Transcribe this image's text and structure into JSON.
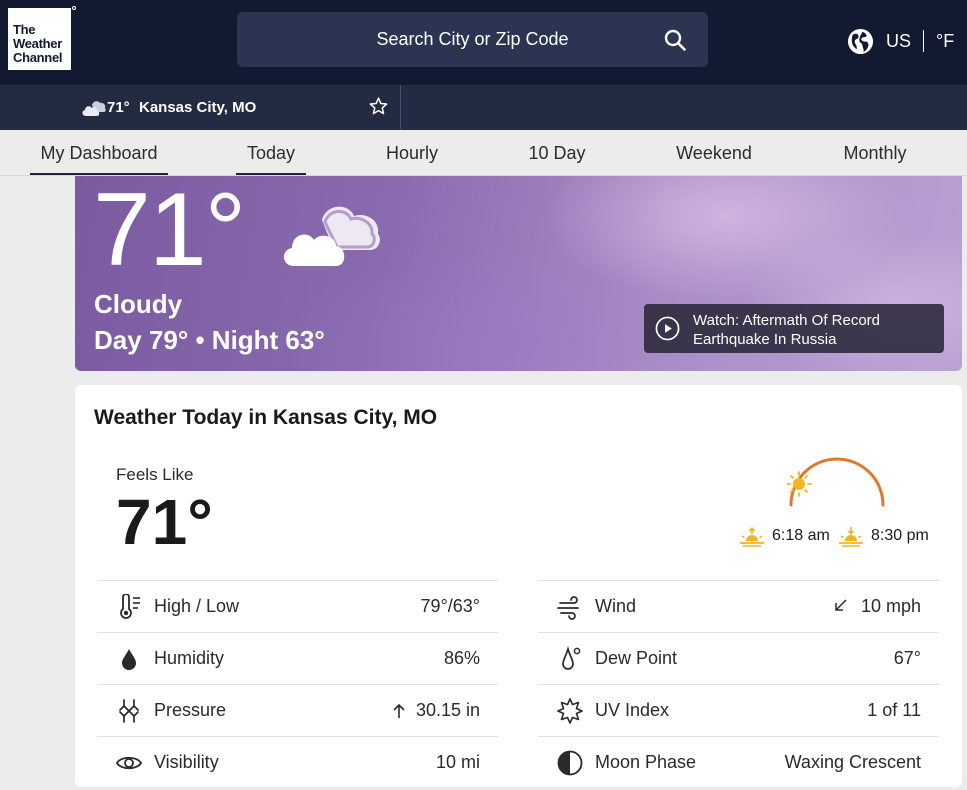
{
  "header": {
    "logo_text": "The\nWeather\nChannel",
    "search_placeholder": "Search City or Zip Code",
    "locale": "US",
    "unit": "°F"
  },
  "location_bar": {
    "temp": "71°",
    "city": "Kansas City, MO"
  },
  "nav": {
    "tabs": [
      {
        "label": "My Dashboard"
      },
      {
        "label": "Today"
      },
      {
        "label": "Hourly"
      },
      {
        "label": "10 Day"
      },
      {
        "label": "Weekend"
      },
      {
        "label": "Monthly"
      }
    ]
  },
  "hero": {
    "temp": "71°",
    "phrase": "Cloudy",
    "day_night": "Day 79° • Night 63°",
    "video_title": "Watch: Aftermath Of Record Earthquake In Russia"
  },
  "today": {
    "title": "Weather Today in Kansas City, MO",
    "feels_like_label": "Feels Like",
    "feels_like_value": "71°",
    "sunrise": "6:18 am",
    "sunset": "8:30 pm",
    "left_details": [
      {
        "label": "High / Low",
        "value": "79°/63°"
      },
      {
        "label": "Humidity",
        "value": "86%"
      },
      {
        "label": "Pressure",
        "value": "30.15 in"
      },
      {
        "label": "Visibility",
        "value": "10 mi"
      }
    ],
    "right_details": [
      {
        "label": "Wind",
        "value": "10 mph"
      },
      {
        "label": "Dew Point",
        "value": "67°"
      },
      {
        "label": "UV Index",
        "value": "1 of 11"
      },
      {
        "label": "Moon Phase",
        "value": "Waxing Crescent"
      }
    ]
  },
  "colors": {
    "header_bg": "#111a30",
    "search_bg": "#2b3551",
    "locbar_bg": "#232b42",
    "hero_purple": "#8a6bb0",
    "sun_arc": "#e0782c",
    "sun_yellow": "#f2b51d"
  }
}
